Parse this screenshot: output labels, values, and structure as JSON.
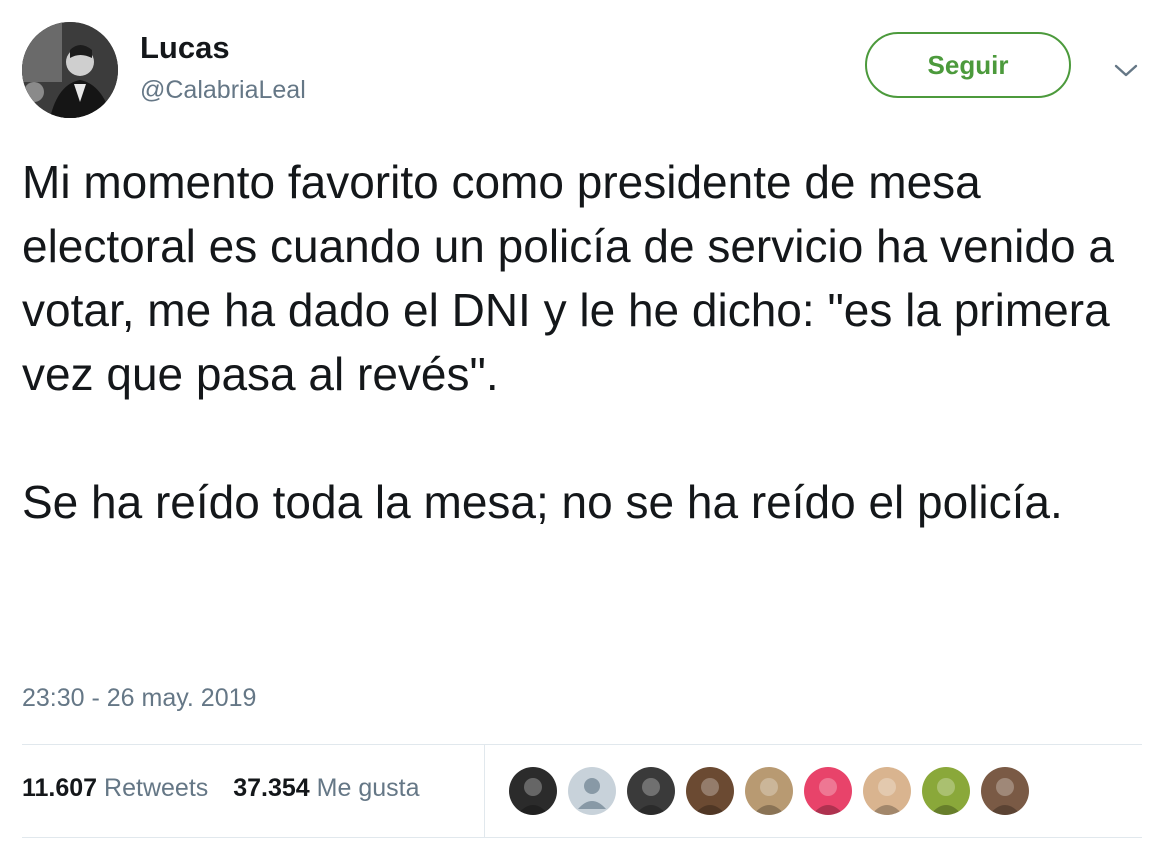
{
  "tweet": {
    "author": {
      "display_name": "Lucas",
      "handle": "@CalabriaLeal",
      "avatar_icon": "profile-photo-icon"
    },
    "follow_label": "Seguir",
    "menu_icon": "chevron-down-icon",
    "paragraphs": [
      "Mi momento favorito como presidente de mesa electoral es cuando un policía de servicio ha venido a votar, me ha dado el DNI y le he dicho: \"es la primera vez que pasa al revés\".",
      "Se ha reído toda la mesa; no se ha reído el policía."
    ],
    "timestamp": "23:30 - 26 may. 2019",
    "stats": {
      "retweets_count": "11.607",
      "retweets_label": "Retweets",
      "likes_count": "37.354",
      "likes_label": "Me gusta"
    },
    "likers": [
      {
        "name": "liker-avatar-1",
        "color": "#2b2b2b"
      },
      {
        "name": "liker-avatar-2",
        "color": "#c8d2da"
      },
      {
        "name": "liker-avatar-3",
        "color": "#3a3a3a"
      },
      {
        "name": "liker-avatar-4",
        "color": "#6b4a32"
      },
      {
        "name": "liker-avatar-5",
        "color": "#b89a72"
      },
      {
        "name": "liker-avatar-6",
        "color": "#e8436a"
      },
      {
        "name": "liker-avatar-7",
        "color": "#d9b48f"
      },
      {
        "name": "liker-avatar-8",
        "color": "#8aa83a"
      },
      {
        "name": "liker-avatar-9",
        "color": "#7a5a45"
      }
    ],
    "colors": {
      "accent_green": "#4c9a3c",
      "text_primary": "#14171a",
      "text_secondary": "#657786",
      "divider": "#e1e8ed"
    }
  }
}
